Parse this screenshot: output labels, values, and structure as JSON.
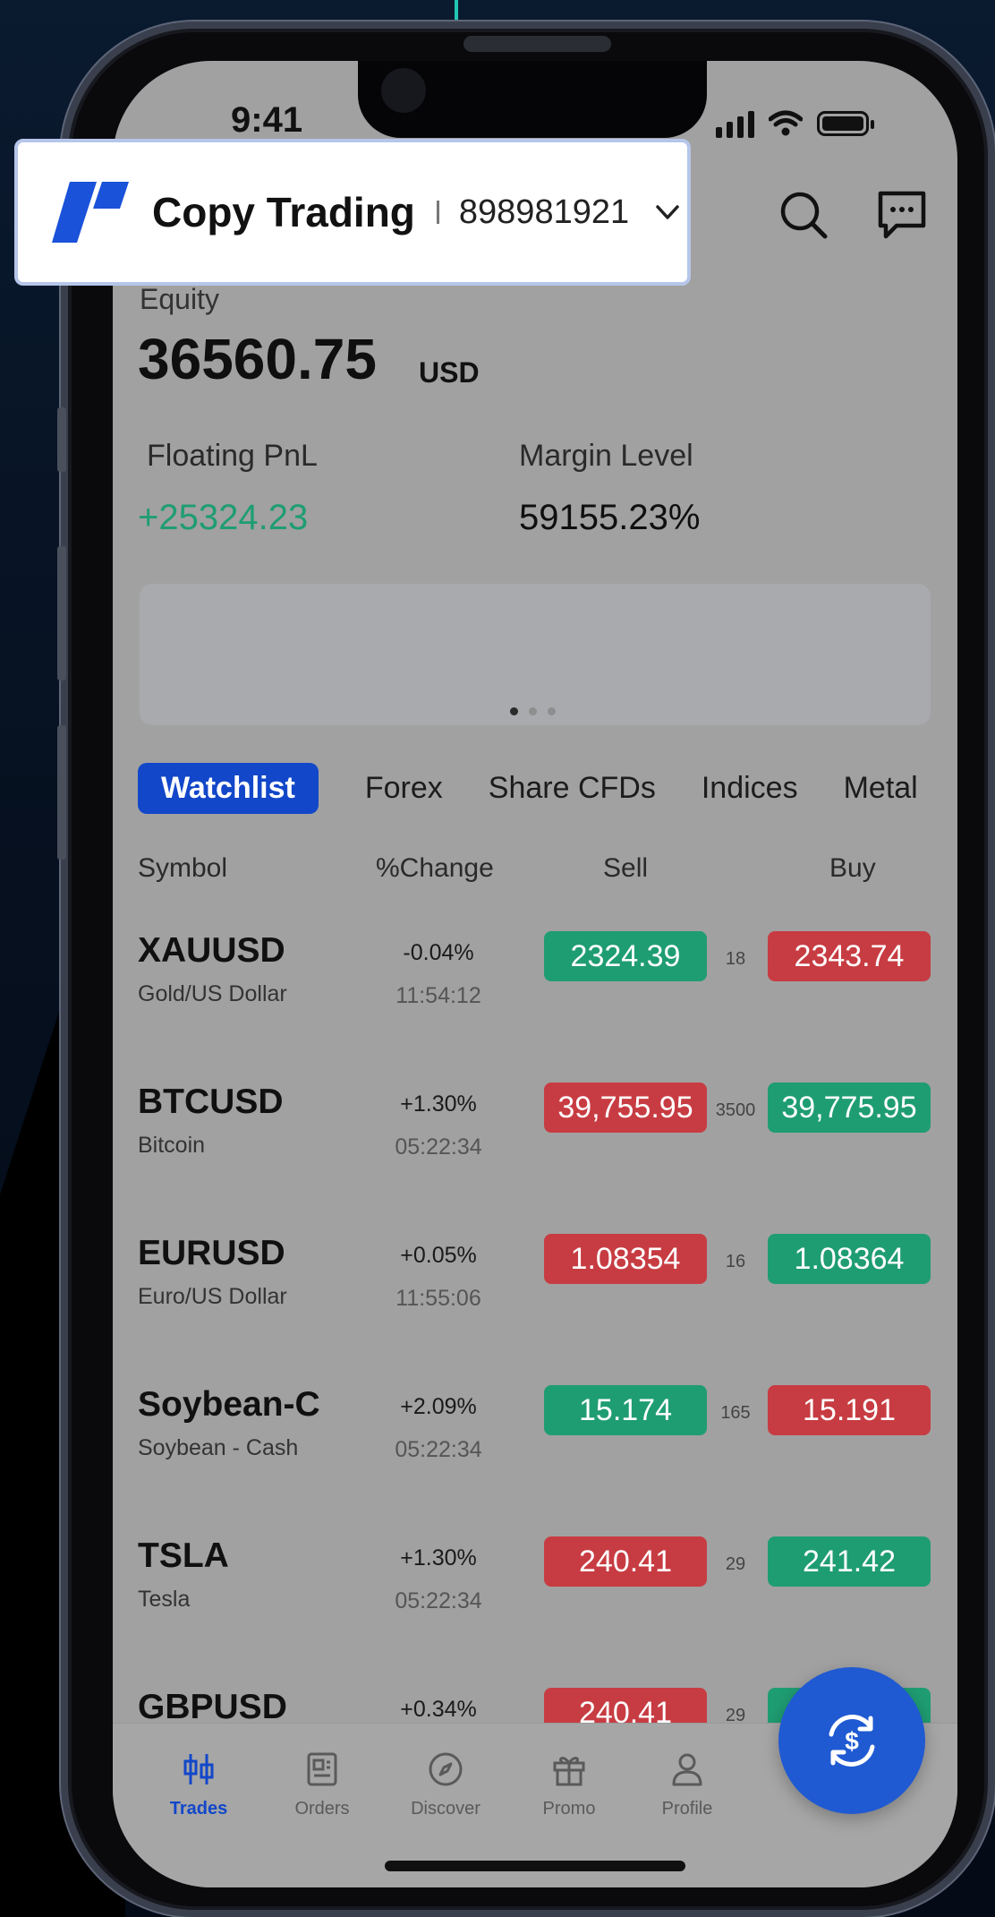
{
  "status_bar": {
    "time": "9:41"
  },
  "account": {
    "title": "Copy Trading",
    "number": "898981921"
  },
  "summary": {
    "equity_label": "Equity",
    "equity_value": "36560.75",
    "equity_unit": "USD",
    "floating_pnl_label": "Floating PnL",
    "floating_pnl_value": "+25324.23",
    "margin_level_label": "Margin Level",
    "margin_level_value": "59155.23%"
  },
  "tabs": [
    "Watchlist",
    "Forex",
    "Share CFDs",
    "Indices",
    "Metal"
  ],
  "columns": {
    "symbol": "Symbol",
    "change": "%Change",
    "sell": "Sell",
    "buy": "Buy"
  },
  "rows": [
    {
      "symbol": "XAUUSD",
      "name": "Gold/US Dollar",
      "change": "-0.04%",
      "time": "11:54:12",
      "sell": "2324.39",
      "spread": "18",
      "buy": "2343.74",
      "sell_color": "green",
      "buy_color": "red"
    },
    {
      "symbol": "BTCUSD",
      "name": "Bitcoin",
      "change": "+1.30%",
      "time": "05:22:34",
      "sell": "39,755.95",
      "spread": "3500",
      "buy": "39,775.95",
      "sell_color": "red",
      "buy_color": "green"
    },
    {
      "symbol": "EURUSD",
      "name": "Euro/US Dollar",
      "change": "+0.05%",
      "time": "11:55:06",
      "sell": "1.08354",
      "spread": "16",
      "buy": "1.08364",
      "sell_color": "red",
      "buy_color": "green"
    },
    {
      "symbol": "Soybean-C",
      "name": "Soybean - Cash",
      "change": "+2.09%",
      "time": "05:22:34",
      "sell": "15.174",
      "spread": "165",
      "buy": "15.191",
      "sell_color": "green",
      "buy_color": "red"
    },
    {
      "symbol": "TSLA",
      "name": "Tesla",
      "change": "+1.30%",
      "time": "05:22:34",
      "sell": "240.41",
      "spread": "29",
      "buy": "241.42",
      "sell_color": "red",
      "buy_color": "green"
    },
    {
      "symbol": "GBPUSD",
      "name": "",
      "change": "+0.34%",
      "time": "",
      "sell": "240.41",
      "spread": "29",
      "buy": "2",
      "sell_color": "red",
      "buy_color": "green"
    }
  ],
  "bottom_nav": [
    {
      "label": "Trades",
      "icon": "candlestick-icon",
      "active": true
    },
    {
      "label": "Orders",
      "icon": "orders-icon",
      "active": false
    },
    {
      "label": "Discover",
      "icon": "compass-icon",
      "active": false
    },
    {
      "label": "Promo",
      "icon": "gift-icon",
      "active": false
    },
    {
      "label": "Profile",
      "icon": "profile-icon",
      "active": false
    }
  ],
  "colors": {
    "accent": "#1247c9",
    "positive": "#1f9d72",
    "negative": "#c73c42",
    "pnl_text": "#1f9d72"
  }
}
